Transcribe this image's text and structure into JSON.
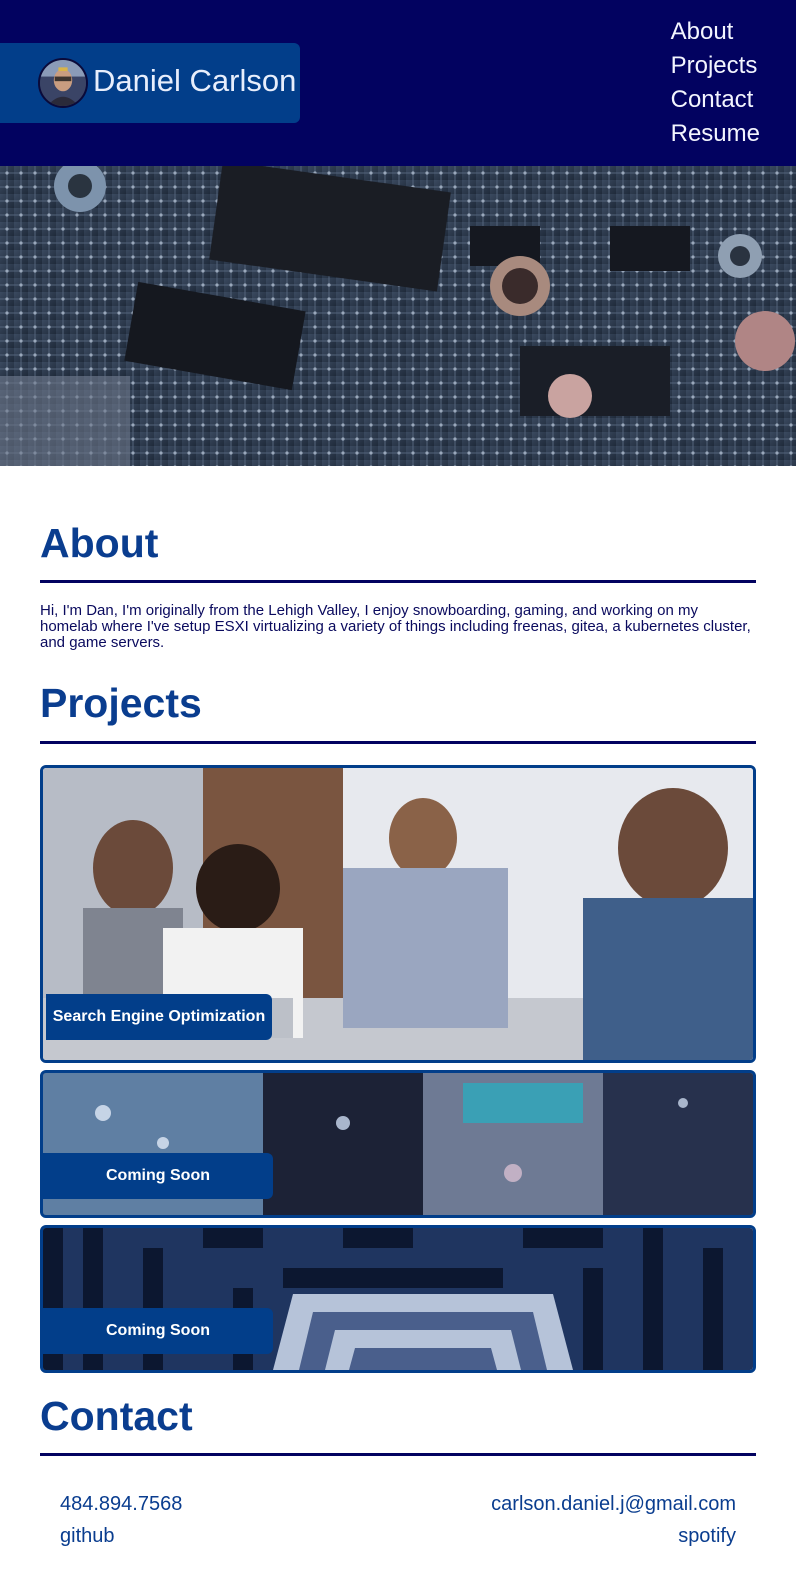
{
  "header": {
    "brand_name": "Daniel Carlson",
    "nav": [
      "About",
      "Projects",
      "Contact",
      "Resume"
    ]
  },
  "about": {
    "title": "About",
    "text": "Hi, I'm Dan, I'm originally from the Lehigh Valley, I enjoy snowboarding, gaming, and working on my homelab where I've setup ESXI virtualizing a variety of things including freenas, gitea, a kubernetes cluster, and game servers."
  },
  "projects": {
    "title": "Projects",
    "cards": [
      {
        "label": "Search Engine Optimization"
      },
      {
        "label": "Coming Soon"
      },
      {
        "label": "Coming Soon"
      }
    ]
  },
  "contact": {
    "title": "Contact",
    "phone": "484.894.7568",
    "email": "carlson.daniel.j@gmail.com",
    "github": "github",
    "spotify": "spotify"
  },
  "colors": {
    "header_bg": "#020260",
    "accent": "#023e8a",
    "heading": "#0a3d8f"
  }
}
